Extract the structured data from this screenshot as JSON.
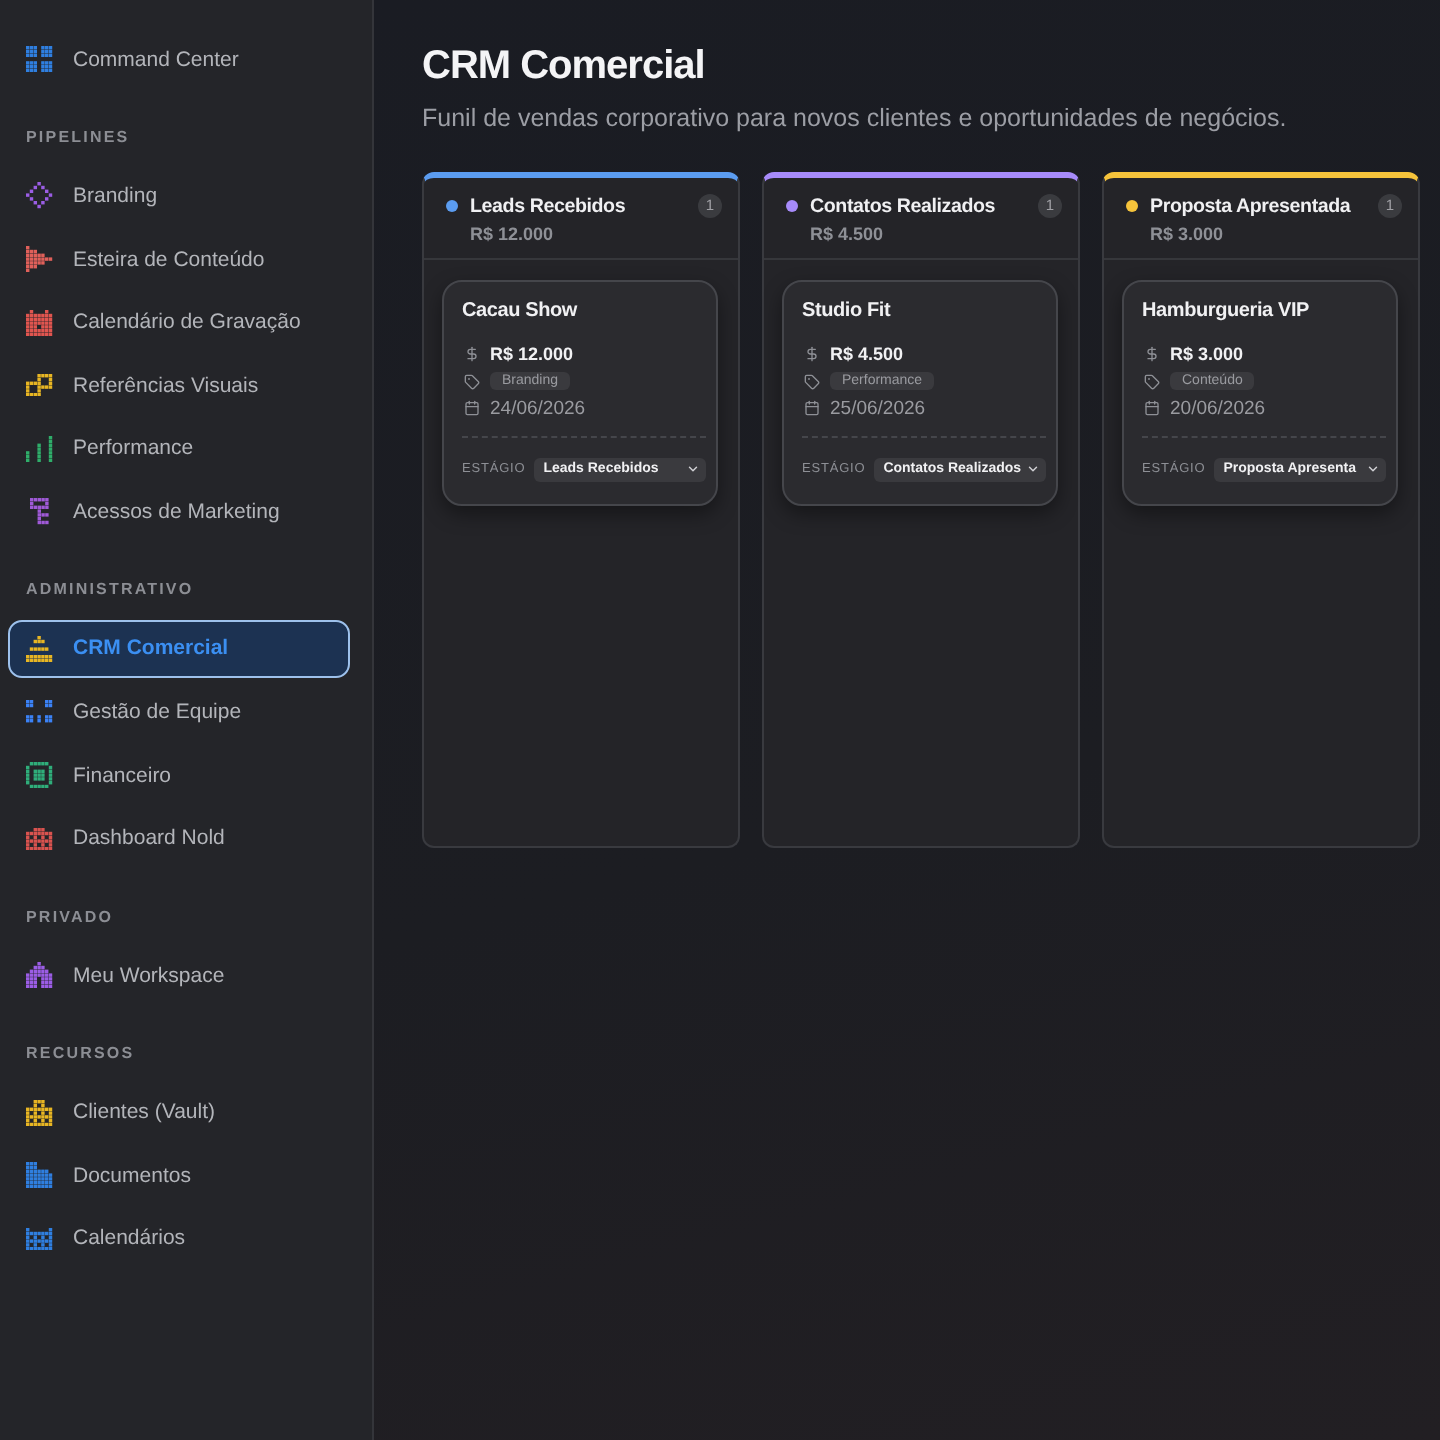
{
  "sidebar": {
    "top_item": {
      "label": "Command Center",
      "color": "#2f7fe0",
      "selected": false
    },
    "sections": [
      {
        "title": "PIPELINES",
        "items": [
          {
            "label": "Branding",
            "color": "#9b5de5",
            "selected": false
          },
          {
            "label": "Esteira de Conteúdo",
            "color": "#e0605a",
            "selected": false
          },
          {
            "label": "Calendário de Gravação",
            "color": "#e0554f",
            "selected": false
          },
          {
            "label": "Referências Visuais",
            "color": "#e8b623",
            "selected": false
          },
          {
            "label": "Performance",
            "color": "#2fae6a",
            "selected": false
          },
          {
            "label": "Acessos de Marketing",
            "color": "#a05ad8",
            "selected": false
          }
        ]
      },
      {
        "title": "ADMINISTRATIVO",
        "items": [
          {
            "label": "CRM Comercial",
            "color": "#e8b623",
            "selected": true
          },
          {
            "label": "Gestão de Equipe",
            "color": "#3b82f6",
            "selected": false
          },
          {
            "label": "Financeiro",
            "color": "#2fae7a",
            "selected": false
          },
          {
            "label": "Dashboard Nold",
            "color": "#d9534f",
            "selected": false
          }
        ]
      },
      {
        "title": "PRIVADO",
        "items": [
          {
            "label": "Meu Workspace",
            "color": "#9b5de5",
            "selected": false
          }
        ]
      },
      {
        "title": "RECURSOS",
        "items": [
          {
            "label": "Clientes (Vault)",
            "color": "#e8b623",
            "selected": false
          },
          {
            "label": "Documentos",
            "color": "#2f7fe0",
            "selected": false
          },
          {
            "label": "Calendários",
            "color": "#2f7fe0",
            "selected": false
          }
        ]
      }
    ]
  },
  "header": {
    "title": "CRM Comercial",
    "subtitle": "Funil de vendas corporativo para novos clientes e oportunidades de negócios."
  },
  "columns": [
    {
      "title": "Leads Recebidos",
      "color": "#5b9cf0",
      "count": "1",
      "total": "R$ 12.000",
      "cards": [
        {
          "name": "Cacau Show",
          "amount": "R$ 12.000",
          "tag": "Branding",
          "date": "24/06/2026",
          "stage_label": "ESTÁGIO",
          "stage": "Leads Recebidos"
        }
      ]
    },
    {
      "title": "Contatos Realizados",
      "color": "#a78bfa",
      "count": "1",
      "total": "R$ 4.500",
      "cards": [
        {
          "name": "Studio Fit",
          "amount": "R$ 4.500",
          "tag": "Performance",
          "date": "25/06/2026",
          "stage_label": "ESTÁGIO",
          "stage": "Contatos Realizados"
        }
      ]
    },
    {
      "title": "Proposta Apresentada",
      "color": "#f5c33b",
      "count": "1",
      "total": "R$ 3.000",
      "cards": [
        {
          "name": "Hamburgueria VIP",
          "amount": "R$ 3.000",
          "tag": "Conteúdo",
          "date": "20/06/2026",
          "stage_label": "ESTÁGIO",
          "stage": "Proposta Apresenta"
        }
      ]
    }
  ]
}
